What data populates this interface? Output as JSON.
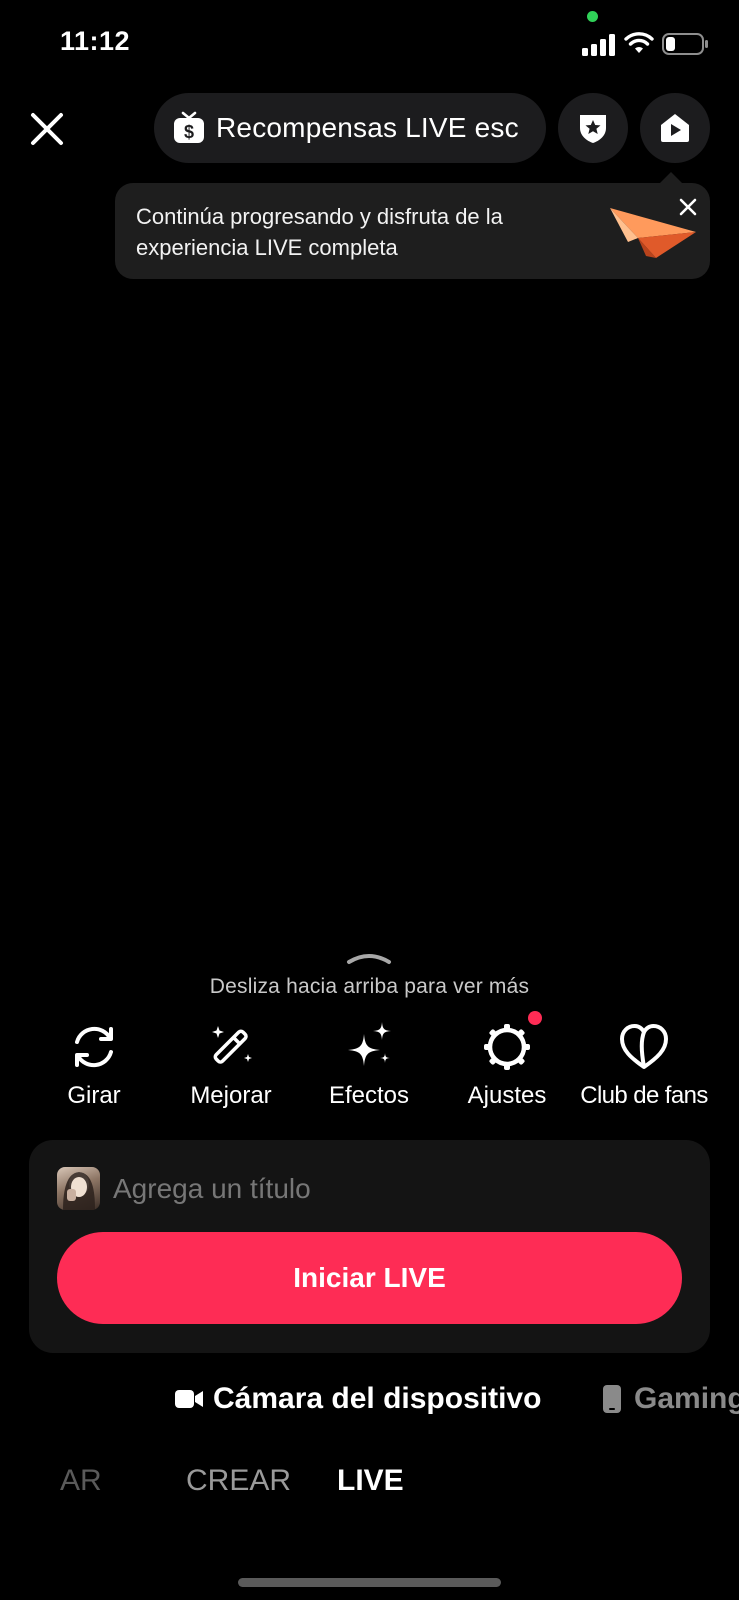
{
  "status_bar": {
    "time": "11:12",
    "privacy_indicator_color": "#30d158",
    "icons": [
      "cellular-signal-icon",
      "wifi-icon",
      "battery-icon"
    ]
  },
  "header": {
    "close_icon": "close-icon",
    "rewards_label": "Recompensas LIVE esc",
    "rewards_icon": "tv-dollar-icon",
    "shield_icon": "shield-star-icon",
    "share_icon": "share-arrow-icon"
  },
  "tooltip": {
    "text": "Continúa progresando y disfruta de la experiencia LIVE completa",
    "icon": "paper-plane-icon"
  },
  "swipe_hint": {
    "text": "Desliza hacia arriba para ver más"
  },
  "tools": [
    {
      "label": "Girar",
      "icon": "rotate-icon"
    },
    {
      "label": "Mejorar",
      "icon": "magic-wand-icon"
    },
    {
      "label": "Efectos",
      "icon": "sparkles-icon"
    },
    {
      "label": "Ajustes",
      "icon": "settings-gear-icon",
      "badge": true
    },
    {
      "label": "Club de fans",
      "icon": "heart-icon"
    }
  ],
  "card": {
    "title_placeholder": "Agrega un título",
    "start_button": "Iniciar LIVE"
  },
  "sources": {
    "camera": "Cámara del dispositivo",
    "gaming": "Gaming"
  },
  "modes": {
    "partial": "AR",
    "crear": "CREAR",
    "live": "LIVE",
    "active": "LIVE"
  },
  "colors": {
    "accent": "#fe2c55",
    "background": "#000000",
    "surface": "#1c1c1e"
  }
}
